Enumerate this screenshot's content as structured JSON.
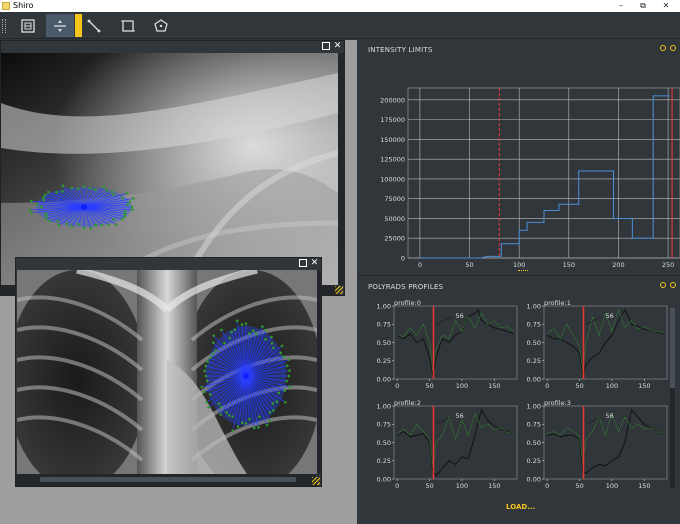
{
  "window": {
    "title": "Shiro"
  },
  "toolbar": {
    "tools": [
      {
        "icon": "image-frame-icon"
      },
      {
        "icon": "horizontal-split-icon"
      },
      {
        "icon": "line-measure-icon"
      },
      {
        "icon": "crop-rectangle-icon"
      },
      {
        "icon": "polygon-roi-icon"
      }
    ],
    "accent_color": "#f5c518"
  },
  "subwindows": [
    {
      "name": "xray-view-1"
    },
    {
      "name": "xray-view-2"
    }
  ],
  "intensity_limits": {
    "title": "INTENSITY LIMITS",
    "chart_data": {
      "type": "line",
      "x": [
        0,
        62,
        68,
        68,
        82,
        82,
        100,
        100,
        108,
        108,
        125,
        125,
        140,
        140,
        160,
        160,
        170,
        170,
        195,
        195,
        214,
        214,
        235,
        235,
        245,
        245,
        252
      ],
      "y": [
        0,
        0,
        2000,
        2000,
        2000,
        18000,
        18000,
        35000,
        35000,
        45000,
        45000,
        60000,
        60000,
        68000,
        68000,
        110000,
        110000,
        110000,
        110000,
        50000,
        50000,
        25000,
        25000,
        205000,
        205000,
        205000,
        205000
      ],
      "xlim": [
        -12,
        262
      ],
      "ylim": [
        0,
        215000
      ],
      "xticks": [
        0,
        50,
        100,
        150,
        200,
        250
      ],
      "yticks": [
        0,
        25000,
        50000,
        75000,
        100000,
        125000,
        150000,
        175000,
        200000
      ],
      "limits": [
        80,
        254
      ],
      "grid": true,
      "line_color": "#4a90d9",
      "limit_color": "#e53935"
    }
  },
  "polyrads": {
    "title": "POLYRADS PROFILES",
    "load_label": "LOAD...",
    "chart_data": [
      {
        "type": "line",
        "title": "profile:0",
        "marker_x": 56,
        "marker_label": "56",
        "xlim": [
          -5,
          185
        ],
        "ylim": [
          0,
          1.0
        ],
        "xticks": [
          0,
          50,
          100,
          150
        ],
        "yticks": [
          0.0,
          0.25,
          0.5,
          0.75,
          1.0
        ],
        "series": [
          {
            "color": "#111111",
            "x": [
              0,
              10,
              20,
              30,
              40,
              50,
              55,
              60,
              65,
              70,
              80,
              90,
              100,
              110,
              120,
              125,
              130,
              140,
              150,
              160,
              170,
              180
            ],
            "y": [
              0.6,
              0.55,
              0.62,
              0.5,
              0.55,
              0.3,
              0.05,
              0.3,
              0.45,
              0.55,
              0.5,
              0.6,
              0.65,
              0.85,
              0.9,
              0.95,
              0.8,
              0.75,
              0.7,
              0.68,
              0.65,
              0.62
            ]
          },
          {
            "color": "#2e8b2e",
            "x": [
              0,
              10,
              20,
              30,
              40,
              50,
              55,
              60,
              70,
              80,
              90,
              100,
              110,
              120,
              130,
              140,
              150,
              160,
              170,
              180
            ],
            "y": [
              0.6,
              0.58,
              0.7,
              0.6,
              0.75,
              0.5,
              0.1,
              0.4,
              0.6,
              0.55,
              0.8,
              0.65,
              0.85,
              0.7,
              0.9,
              0.75,
              0.8,
              0.7,
              0.72,
              0.65
            ]
          }
        ]
      },
      {
        "type": "line",
        "title": "profile:1",
        "marker_x": 56,
        "marker_label": "56",
        "xlim": [
          -5,
          185
        ],
        "ylim": [
          0,
          1.0
        ],
        "xticks": [
          0,
          50,
          100,
          150
        ],
        "yticks": [
          0.0,
          0.25,
          0.5,
          0.75,
          1.0
        ],
        "series": [
          {
            "color": "#111111",
            "x": [
              0,
              10,
              20,
              30,
              40,
              50,
              55,
              60,
              70,
              80,
              90,
              100,
              110,
              120,
              125,
              130,
              140,
              150,
              160,
              170,
              180
            ],
            "y": [
              0.6,
              0.55,
              0.55,
              0.5,
              0.45,
              0.35,
              0.05,
              0.2,
              0.3,
              0.35,
              0.5,
              0.6,
              0.8,
              0.95,
              0.85,
              0.75,
              0.72,
              0.68,
              0.66,
              0.64,
              0.62
            ]
          },
          {
            "color": "#2e8b2e",
            "x": [
              0,
              10,
              20,
              30,
              40,
              50,
              55,
              60,
              70,
              80,
              90,
              100,
              110,
              120,
              130,
              140,
              150,
              160,
              170,
              180
            ],
            "y": [
              0.62,
              0.7,
              0.55,
              0.75,
              0.6,
              0.45,
              0.1,
              0.5,
              0.85,
              0.6,
              0.9,
              0.65,
              0.95,
              0.7,
              0.8,
              0.68,
              0.72,
              0.66,
              0.65,
              0.63
            ]
          }
        ]
      },
      {
        "type": "line",
        "title": "profile:2",
        "marker_x": 56,
        "marker_label": "56",
        "xlim": [
          -5,
          185
        ],
        "ylim": [
          0,
          1.0
        ],
        "xticks": [
          0,
          50,
          100,
          150
        ],
        "yticks": [
          0.0,
          0.25,
          0.5,
          0.75,
          1.0
        ],
        "series": [
          {
            "color": "#111111",
            "x": [
              0,
              10,
              20,
              30,
              40,
              50,
              55,
              60,
              70,
              80,
              90,
              100,
              110,
              120,
              130,
              140,
              150,
              160,
              170,
              180
            ],
            "y": [
              0.6,
              0.65,
              0.58,
              0.6,
              0.62,
              0.5,
              0.1,
              0.05,
              0.15,
              0.25,
              0.2,
              0.3,
              0.28,
              0.6,
              0.95,
              0.8,
              0.72,
              0.68,
              0.65,
              0.62
            ]
          },
          {
            "color": "#2e8b2e",
            "x": [
              0,
              10,
              20,
              30,
              40,
              50,
              55,
              60,
              70,
              80,
              90,
              100,
              110,
              120,
              130,
              140,
              150,
              160,
              170,
              180
            ],
            "y": [
              0.62,
              0.68,
              0.6,
              0.75,
              0.65,
              0.55,
              0.15,
              0.5,
              0.6,
              0.85,
              0.55,
              0.8,
              0.6,
              0.9,
              0.7,
              0.75,
              0.68,
              0.7,
              0.64,
              0.63
            ]
          }
        ]
      },
      {
        "type": "line",
        "title": "profile:3",
        "marker_x": 56,
        "marker_label": "56",
        "xlim": [
          -5,
          185
        ],
        "ylim": [
          0,
          1.0
        ],
        "xticks": [
          0,
          50,
          100,
          150
        ],
        "yticks": [
          0.0,
          0.25,
          0.5,
          0.75,
          1.0
        ],
        "series": [
          {
            "color": "#111111",
            "x": [
              0,
              10,
              20,
              30,
              40,
              50,
              55,
              60,
              70,
              80,
              90,
              100,
              110,
              120,
              130,
              140,
              150,
              160,
              170,
              180
            ],
            "y": [
              0.6,
              0.62,
              0.58,
              0.6,
              0.6,
              0.55,
              0.1,
              0.08,
              0.15,
              0.2,
              0.18,
              0.25,
              0.3,
              0.5,
              0.95,
              0.85,
              0.75,
              0.7,
              0.66,
              0.62
            ]
          },
          {
            "color": "#2e8b2e",
            "x": [
              0,
              10,
              20,
              30,
              40,
              50,
              55,
              60,
              70,
              80,
              90,
              100,
              110,
              120,
              130,
              140,
              150,
              160,
              170,
              180
            ],
            "y": [
              0.62,
              0.65,
              0.6,
              0.7,
              0.66,
              0.58,
              0.2,
              0.55,
              0.65,
              0.85,
              0.6,
              0.9,
              0.65,
              0.85,
              0.7,
              0.75,
              0.68,
              0.7,
              0.65,
              0.63
            ]
          }
        ]
      }
    ]
  }
}
